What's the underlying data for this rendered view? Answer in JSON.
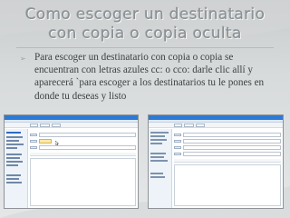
{
  "slide": {
    "title": "Como escoger un destinatario con copia o copia oculta",
    "bullet_icon": "arrow-bullet-icon",
    "body": "Para escoger un destinatario con copia o copia se encuentran con letras azules cc: o cco: darle clic allí y aparecerá `para escoger a los destinatarios tu le pones en donde tu deseas y listo"
  },
  "colors": {
    "title": "#8a9194",
    "body": "#3e4244",
    "app_header": "#2d7ad6",
    "highlight": "#ffe8a6"
  }
}
